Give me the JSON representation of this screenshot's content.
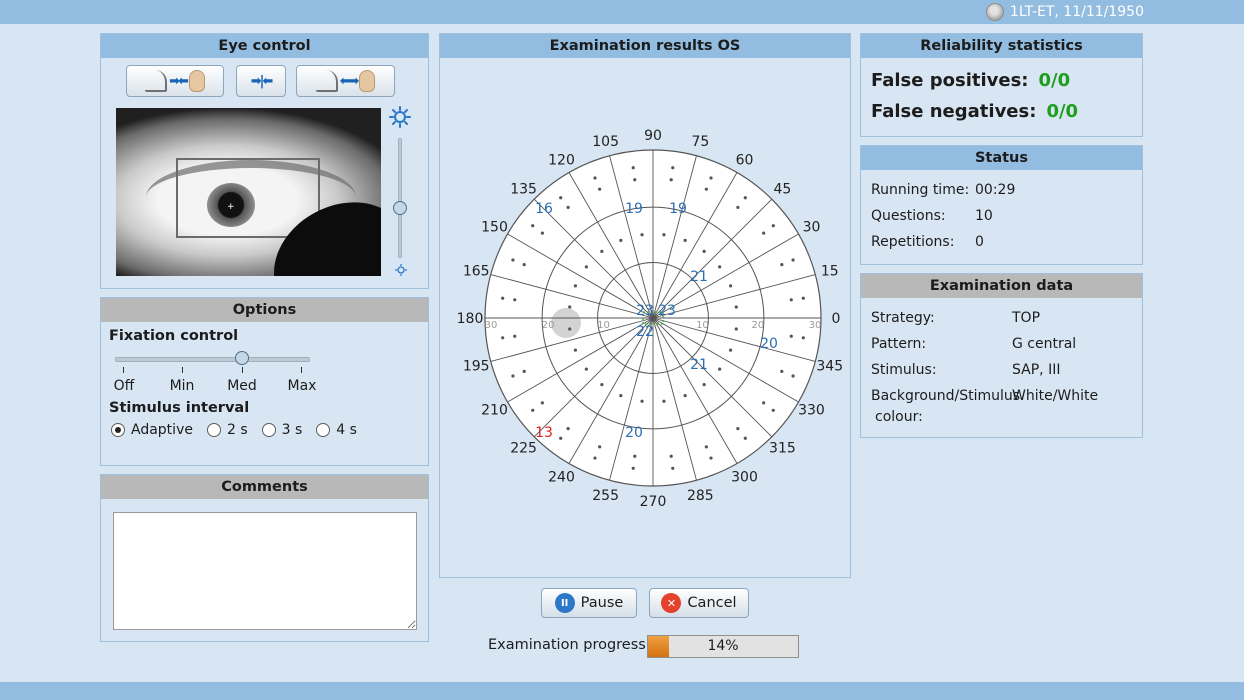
{
  "header": {
    "patient": "1LT-ET, 11/11/1950"
  },
  "eye_control": {
    "title": "Eye control"
  },
  "options": {
    "title": "Options",
    "fixation_label": "Fixation control",
    "fixation_levels": [
      "Off",
      "Min",
      "Med",
      "Max"
    ],
    "fixation_selected": "Med",
    "interval_label": "Stimulus interval",
    "interval_options": [
      "Adaptive",
      "2 s",
      "3 s",
      "4 s"
    ],
    "interval_selected": "Adaptive"
  },
  "comments": {
    "title": "Comments",
    "value": ""
  },
  "results": {
    "title": "Examination results OS",
    "angle_labels": [
      "0",
      "15",
      "30",
      "45",
      "60",
      "75",
      "90",
      "105",
      "120",
      "135",
      "150",
      "165",
      "180",
      "195",
      "210",
      "225",
      "240",
      "255",
      "270",
      "285",
      "300",
      "315",
      "330",
      "345"
    ],
    "eccentricity_labels": [
      "10",
      "20",
      "30"
    ],
    "stimulus_values": [
      {
        "text": "16",
        "color": "#2a6fb5"
      },
      {
        "text": "19",
        "color": "#2a6fb5"
      },
      {
        "text": "19",
        "color": "#2a6fb5"
      },
      {
        "text": "21",
        "color": "#2a6fb5"
      },
      {
        "text": "23",
        "color": "#2a6fb5"
      },
      {
        "text": "23",
        "color": "#2a6fb5"
      },
      {
        "text": "22",
        "color": "#2a6fb5"
      },
      {
        "text": "20",
        "color": "#2a6fb5"
      },
      {
        "text": "21",
        "color": "#2a6fb5"
      },
      {
        "text": "13",
        "color": "#e02020"
      },
      {
        "text": "20",
        "color": "#2a6fb5"
      }
    ]
  },
  "reliability": {
    "title": "Reliability statistics",
    "fp_label": "False positives:",
    "fp_value": "0/0",
    "fn_label": "False negatives:",
    "fn_value": "0/0"
  },
  "status": {
    "title": "Status",
    "running_label": "Running time:",
    "running_value": "00:29",
    "questions_label": "Questions:",
    "questions_value": "10",
    "repetitions_label": "Repetitions:",
    "repetitions_value": "0"
  },
  "exam_data": {
    "title": "Examination data",
    "strategy_label": "Strategy:",
    "strategy_value": "TOP",
    "pattern_label": "Pattern:",
    "pattern_value": "G central",
    "stimulus_label": "Stimulus:",
    "stimulus_value": "SAP, III",
    "bg_label_1": "Background/Stimulus",
    "bg_label_2": "colour:",
    "bg_value": "White/White"
  },
  "controls": {
    "pause_label": "Pause",
    "cancel_label": "Cancel",
    "progress_label": "Examination progress",
    "progress_value": "14%",
    "progress_fraction": 0.14
  },
  "colors": {
    "header_blue": "#93bde0",
    "header_gray": "#b8b8b8",
    "value_green": "#1e9e1e",
    "progress_orange": "#e08a2a"
  }
}
